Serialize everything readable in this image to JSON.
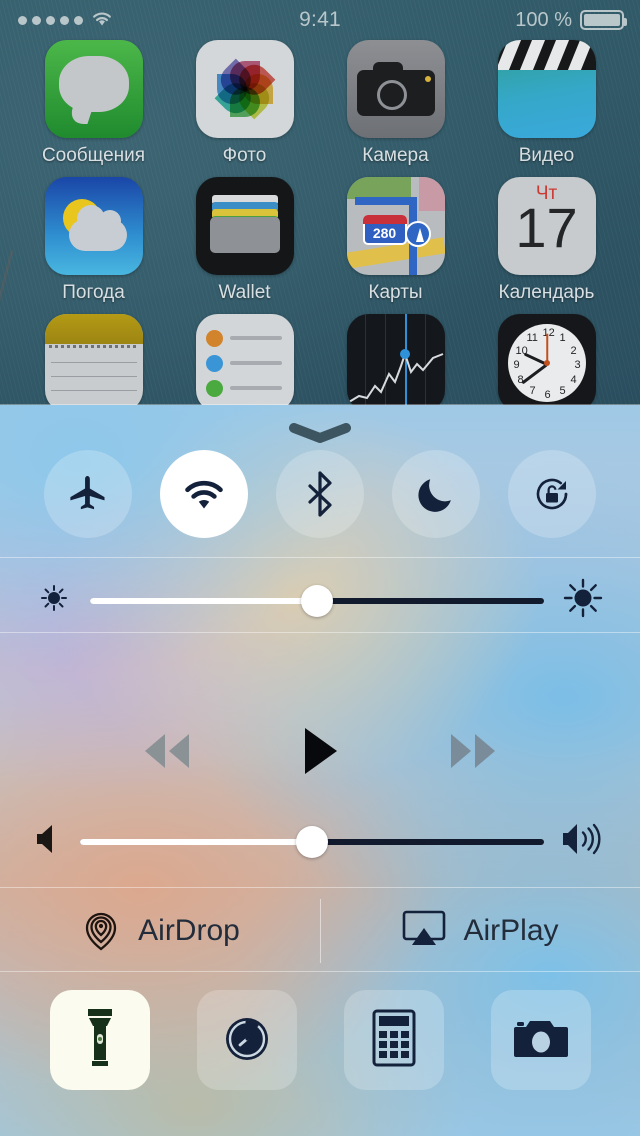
{
  "status_bar": {
    "signal_dots": 5,
    "wifi_icon": "wifi-icon",
    "time": "9:41",
    "battery_percent": "100 %",
    "battery_icon": "battery-full-icon"
  },
  "home_screen": {
    "rows": [
      [
        {
          "label": "Сообщения",
          "icon": "messages-icon"
        },
        {
          "label": "Фото",
          "icon": "photos-icon"
        },
        {
          "label": "Камера",
          "icon": "camera-icon"
        },
        {
          "label": "Видео",
          "icon": "videos-icon"
        }
      ],
      [
        {
          "label": "Погода",
          "icon": "weather-icon"
        },
        {
          "label": "Wallet",
          "icon": "wallet-icon"
        },
        {
          "label": "Карты",
          "icon": "maps-icon"
        },
        {
          "label": "Календарь",
          "icon": "calendar-icon"
        }
      ],
      [
        {
          "label": "",
          "icon": "notes-icon"
        },
        {
          "label": "",
          "icon": "reminders-icon"
        },
        {
          "label": "",
          "icon": "stocks-icon"
        },
        {
          "label": "",
          "icon": "clock-icon"
        }
      ]
    ],
    "maps_shield_number": "280",
    "calendar": {
      "weekday": "Чт",
      "day": "17"
    },
    "clock_numerals": [
      "12",
      "1",
      "2",
      "3",
      "4",
      "5",
      "6",
      "7",
      "8",
      "9",
      "10",
      "11"
    ]
  },
  "control_center": {
    "grabber": "grabber-handle",
    "toggles": [
      {
        "name": "airplane-mode-toggle",
        "icon": "airplane-icon",
        "active": false
      },
      {
        "name": "wifi-toggle",
        "icon": "wifi-icon",
        "active": true
      },
      {
        "name": "bluetooth-toggle",
        "icon": "bluetooth-icon",
        "active": false
      },
      {
        "name": "do-not-disturb-toggle",
        "icon": "moon-icon",
        "active": false
      },
      {
        "name": "rotation-lock-toggle",
        "icon": "rotation-lock-icon",
        "active": false
      }
    ],
    "brightness_slider": {
      "name": "brightness-slider",
      "value_percent": 50,
      "min_icon": "brightness-low-icon",
      "max_icon": "brightness-high-icon"
    },
    "media": {
      "rewind": {
        "name": "rewind-button",
        "icon": "rewind-icon"
      },
      "play": {
        "name": "play-button",
        "icon": "play-icon"
      },
      "forward": {
        "name": "fast-forward-button",
        "icon": "fast-forward-icon"
      }
    },
    "volume_slider": {
      "name": "volume-slider",
      "value_percent": 50,
      "min_icon": "volume-mute-icon",
      "max_icon": "volume-high-icon"
    },
    "share": [
      {
        "name": "airdrop-button",
        "label": "AirDrop",
        "icon": "airdrop-icon"
      },
      {
        "name": "airplay-button",
        "label": "AirPlay",
        "icon": "airplay-icon"
      }
    ],
    "shortcuts": [
      {
        "name": "flashlight-button",
        "icon": "flashlight-icon",
        "active": true
      },
      {
        "name": "timer-button",
        "icon": "timer-icon",
        "active": false
      },
      {
        "name": "calculator-button",
        "icon": "calculator-icon",
        "active": false
      },
      {
        "name": "camera-button",
        "icon": "camera-icon",
        "active": false
      }
    ]
  },
  "colors": {
    "glyph_dark": "#14213a",
    "status_text": "#b9c6ca",
    "accent_active": "#ffffff"
  }
}
